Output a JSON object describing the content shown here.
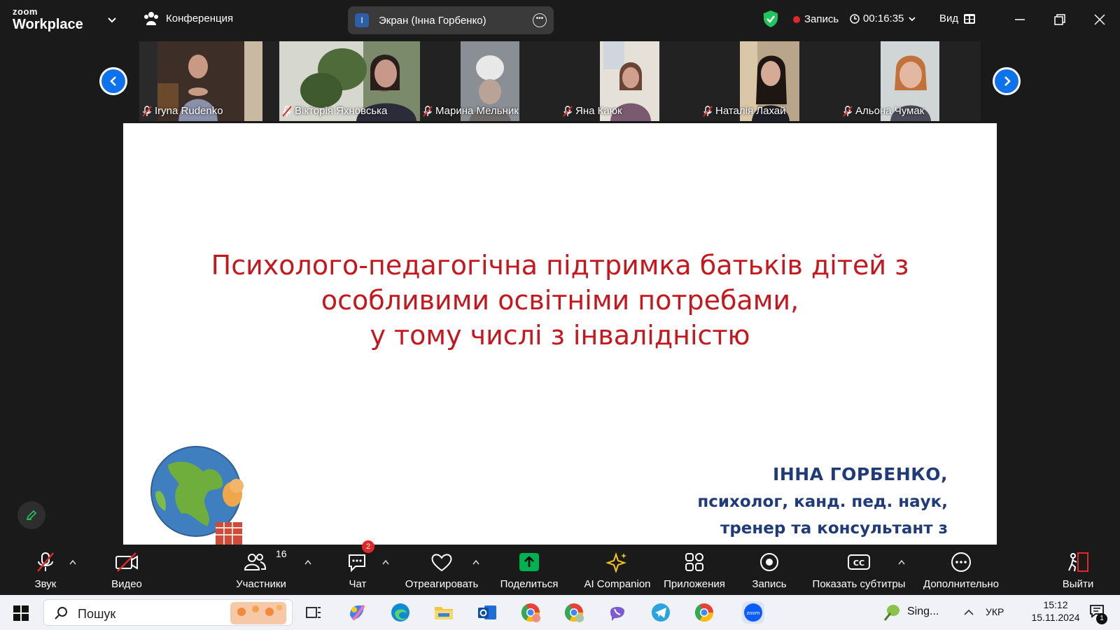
{
  "topbar": {
    "logo_line1": "zoom",
    "logo_line2": "Workplace",
    "conference_label": "Конференция",
    "screen_share_initial": "I",
    "screen_share_label": "Экран (Інна Горбенко)",
    "recording_label": "Запись",
    "timer": "00:16:35",
    "view_label": "Вид"
  },
  "participants": [
    {
      "name": "Iryna Rudenko"
    },
    {
      "name": "Вікторія Яхновська"
    },
    {
      "name": "Марина Мельник"
    },
    {
      "name": "Яна Каюк"
    },
    {
      "name": "Наталія Лахай"
    },
    {
      "name": "Альона Чумак"
    }
  ],
  "slide": {
    "title_lines": [
      "Психолого-педагогічна підтримка батьків дітей з",
      "особливими освітніми потребами,",
      "у тому числі з інвалідністю"
    ],
    "author_name": "ІННА  ГОРБЕНКО,",
    "author_line2": "психолог, канд. пед. наук,",
    "author_line3": "тренер та консультант з",
    "title_color": "#c8161d",
    "author_color": "#1f3b7a"
  },
  "toolbar": {
    "audio": "Звук",
    "video": "Видео",
    "participants": "Участники",
    "participants_count": "16",
    "chat": "Чат",
    "chat_badge": "2",
    "react": "Отреагировать",
    "share": "Поделиться",
    "ai": "AI Companion",
    "apps": "Приложения",
    "record": "Запись",
    "captions": "Показать субтитры",
    "more": "Дополнительно",
    "leave": "Выйти"
  },
  "taskbar": {
    "search_label": "Пошук",
    "tray_app": "Sing...",
    "language": "УКР",
    "time": "15:12",
    "date": "15.11.2024",
    "notification_count": "1"
  },
  "colors": {
    "accent": "#0e72ed",
    "share_green": "#00b14f",
    "record_red": "#e02828"
  }
}
